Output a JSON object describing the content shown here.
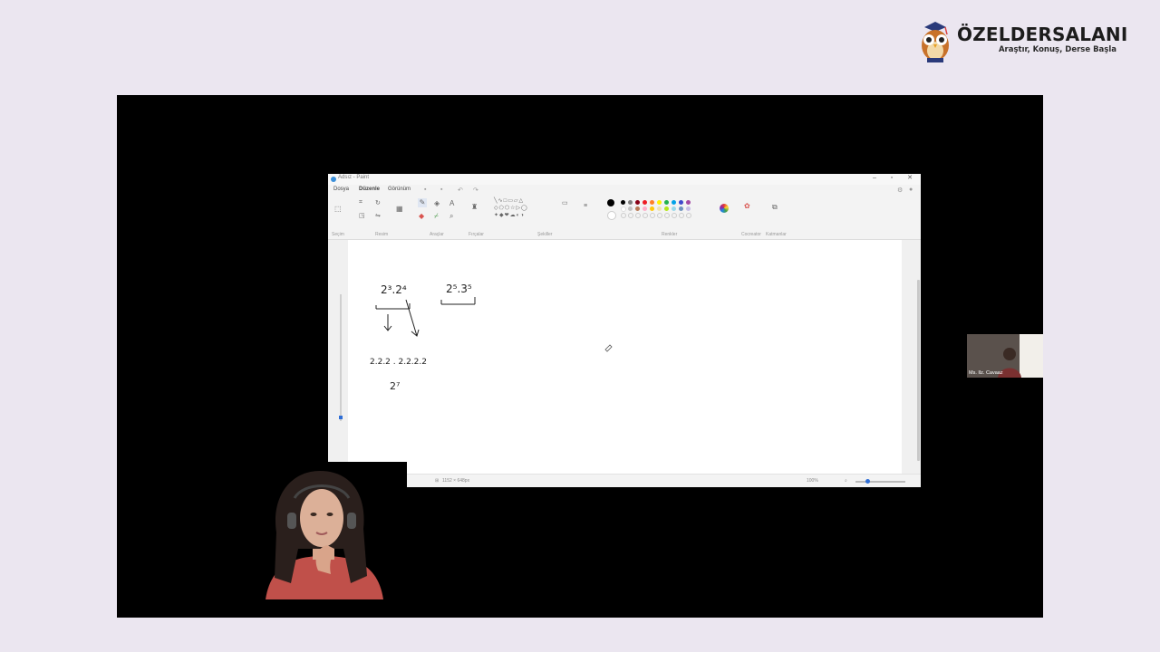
{
  "brand": {
    "name": "ÖZELDERSALANI",
    "tagline": "Araştır, Konuş, Derse Başla"
  },
  "paint": {
    "title": "Adsız - Paint",
    "menus": [
      "Dosya",
      "Düzenle",
      "Görünüm"
    ],
    "ribbon_groups": [
      "Seçim",
      "Resim",
      "Araçlar",
      "Fırçalar",
      "Şekiller",
      "Renkler",
      "Cocreator",
      "Katmanlar"
    ],
    "handwriting": {
      "expr1": "2³.2⁴",
      "expr2": "2⁵.3⁵",
      "expanded": "2.2.2 . 2.2.2.2",
      "result": "2⁷"
    },
    "status": {
      "canvas_size": "1152 × 648px",
      "zoom": "100%"
    }
  },
  "participant": {
    "name": "Ms. Ilz. Cavaaz"
  },
  "colors": {
    "page_bg": "#ebe6f0",
    "stage_bg": "#000000",
    "accent": "#2f6ed6"
  }
}
